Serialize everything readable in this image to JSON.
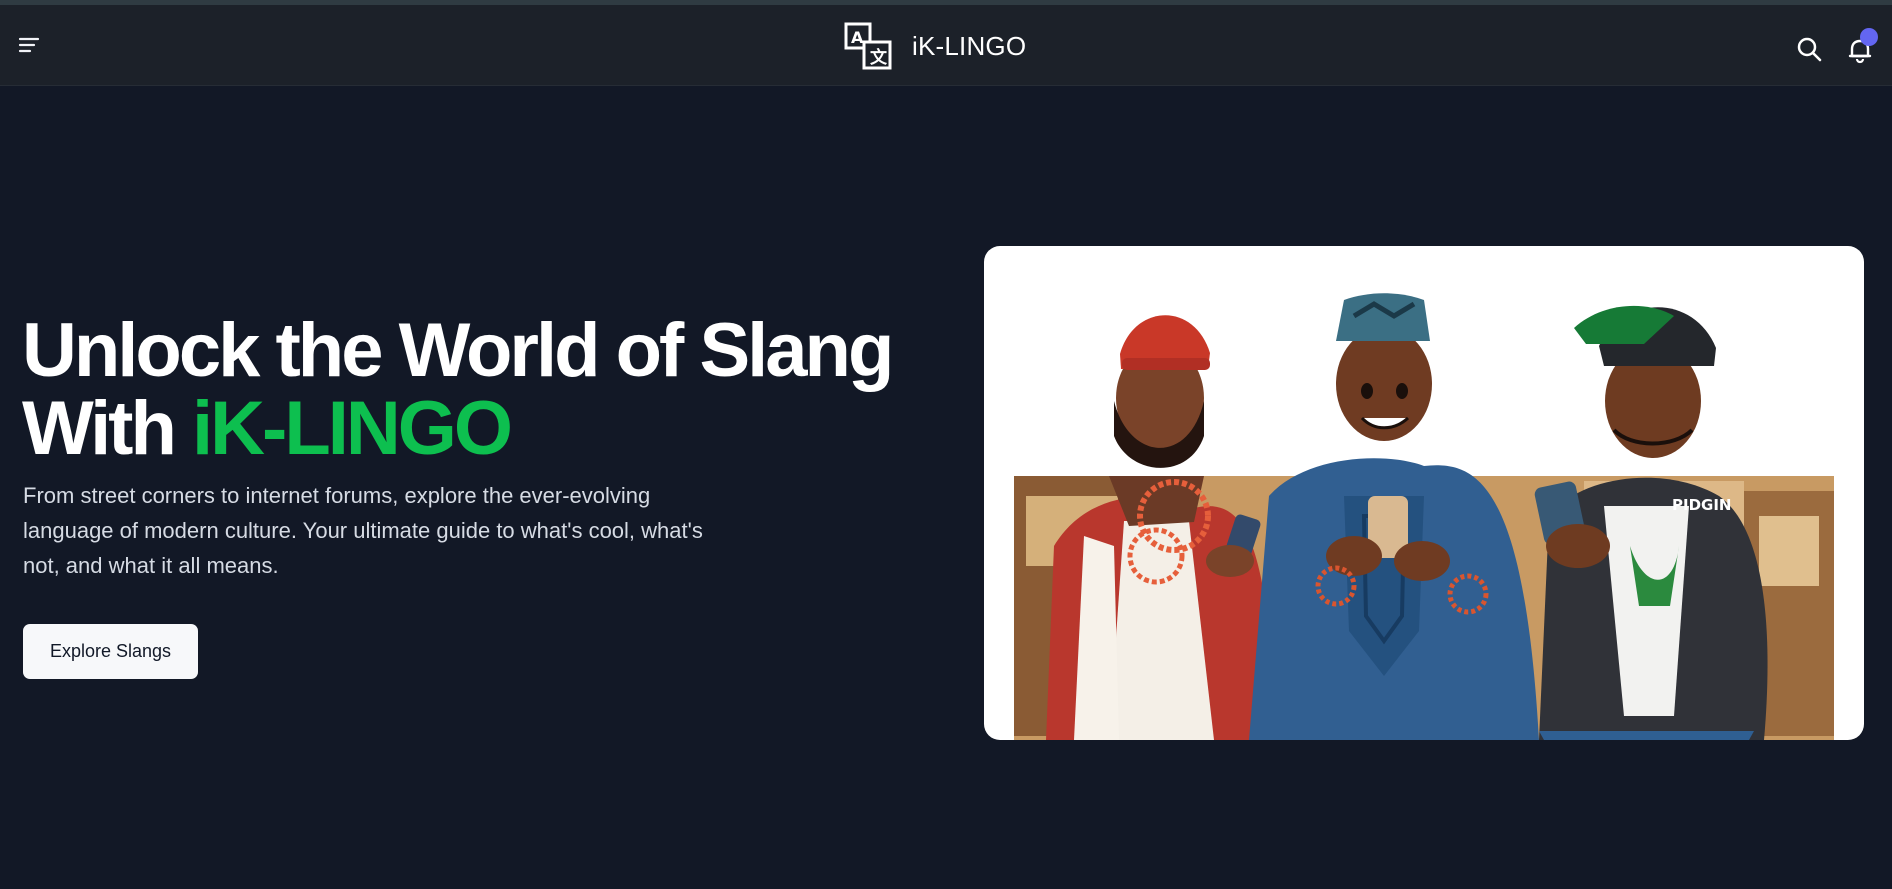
{
  "header": {
    "app_name": "iK-LINGO",
    "icons": {
      "menu": "menu-icon",
      "logo": "translate-logo-icon",
      "search": "search-icon",
      "notifications": "bell-icon"
    }
  },
  "hero": {
    "title_line1": "Unlock the World of Slang",
    "title_line2_prefix": "With ",
    "title_line2_brand": "iK-LINGO",
    "description": "From street corners to internet forums, explore the ever-evolving language of modern culture. Your ultimate guide to what's cool, what's not, and what it all means.",
    "cta_label": "Explore Slangs",
    "image_text": "PIDGIN"
  },
  "colors": {
    "background": "#121826",
    "header": "#1c2129",
    "accent": "#0dbf4f",
    "notification": "#6366f1"
  }
}
